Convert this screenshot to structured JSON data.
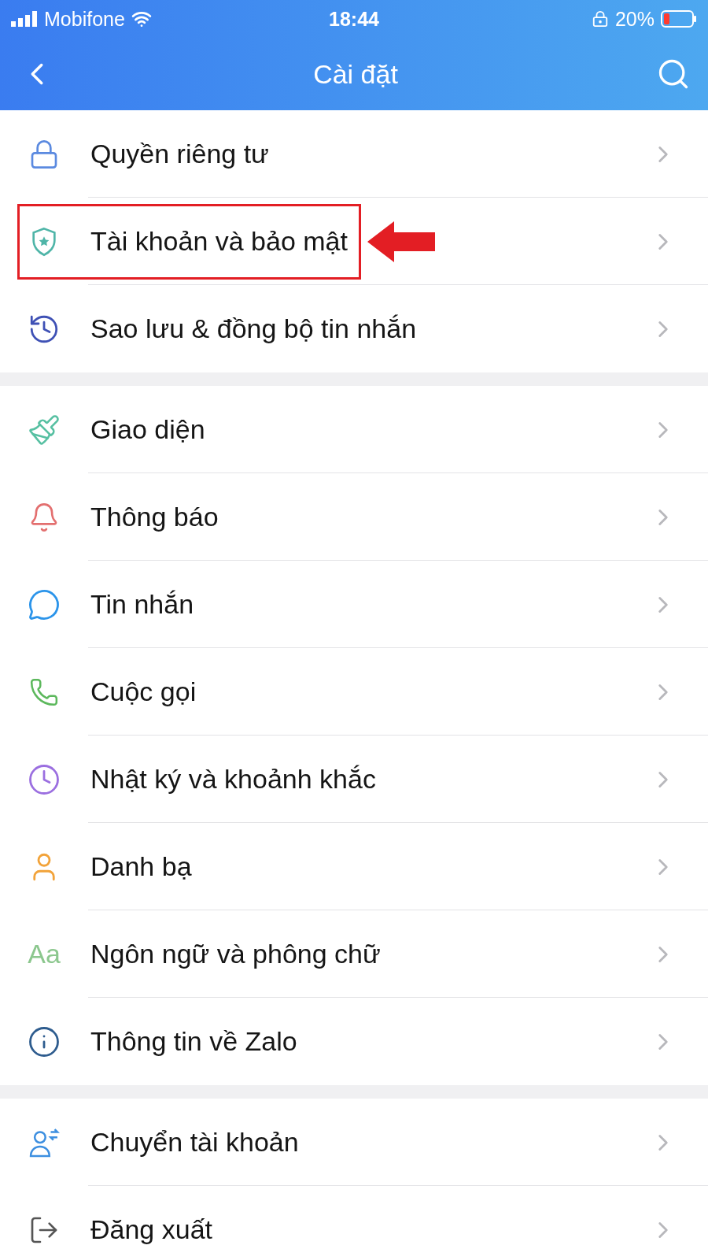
{
  "status_bar": {
    "carrier": "Mobifone",
    "time": "18:44",
    "battery": "20%"
  },
  "header": {
    "title": "Cài đặt"
  },
  "sections": [
    {
      "items": [
        {
          "label": "Quyền riêng tư",
          "highlighted": false
        },
        {
          "label": "Tài khoản và bảo mật",
          "highlighted": true
        },
        {
          "label": "Sao lưu & đồng bộ tin nhắn",
          "highlighted": false
        }
      ]
    },
    {
      "items": [
        {
          "label": "Giao diện",
          "highlighted": false
        },
        {
          "label": "Thông báo",
          "highlighted": false
        },
        {
          "label": "Tin nhắn",
          "highlighted": false
        },
        {
          "label": "Cuộc gọi",
          "highlighted": false
        },
        {
          "label": "Nhật ký và khoảnh khắc",
          "highlighted": false
        },
        {
          "label": "Danh bạ",
          "highlighted": false
        },
        {
          "label": "Ngôn ngữ và phông chữ",
          "highlighted": false,
          "icon_text": "Aa"
        },
        {
          "label": "Thông tin về Zalo",
          "highlighted": false
        }
      ]
    },
    {
      "items": [
        {
          "label": "Chuyển tài khoản",
          "highlighted": false
        },
        {
          "label": "Đăng xuất",
          "highlighted": false
        }
      ]
    }
  ]
}
